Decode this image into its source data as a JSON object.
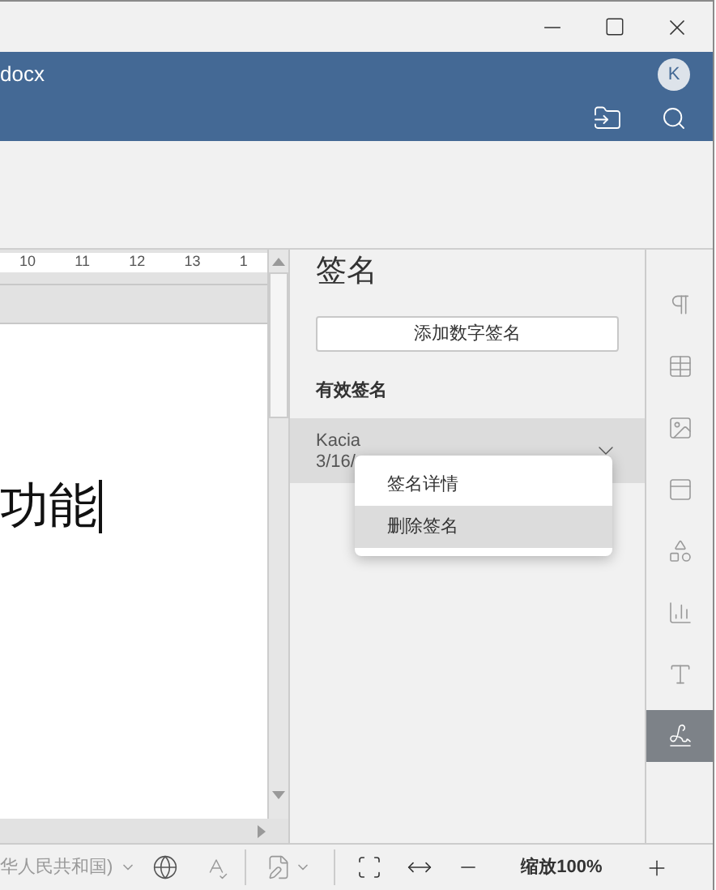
{
  "header": {
    "title": "docx",
    "avatar": "K"
  },
  "ruler": {
    "labels": [
      "10",
      "11",
      "12",
      "13",
      "1"
    ]
  },
  "document": {
    "text": "功能"
  },
  "panel": {
    "title": "签名",
    "add_button": "添加数字签名",
    "section": "有效签名",
    "signatures": [
      {
        "name": "Kacia",
        "date": "3/16/",
        "expanded": true
      }
    ],
    "menu": [
      {
        "label": "签名详情",
        "selected": false
      },
      {
        "label": "删除签名",
        "selected": true
      }
    ]
  },
  "sidebar": {
    "items": [
      {
        "kind": "paragraph",
        "selected": false
      },
      {
        "kind": "table",
        "selected": false
      },
      {
        "kind": "image",
        "selected": false
      },
      {
        "kind": "header",
        "selected": false
      },
      {
        "kind": "shape",
        "selected": false
      },
      {
        "kind": "chart",
        "selected": false
      },
      {
        "kind": "textart",
        "selected": false
      },
      {
        "kind": "signature",
        "selected": true
      }
    ]
  },
  "status_bar": {
    "language": "华人民共和国)",
    "zoom": "缩放100%"
  }
}
